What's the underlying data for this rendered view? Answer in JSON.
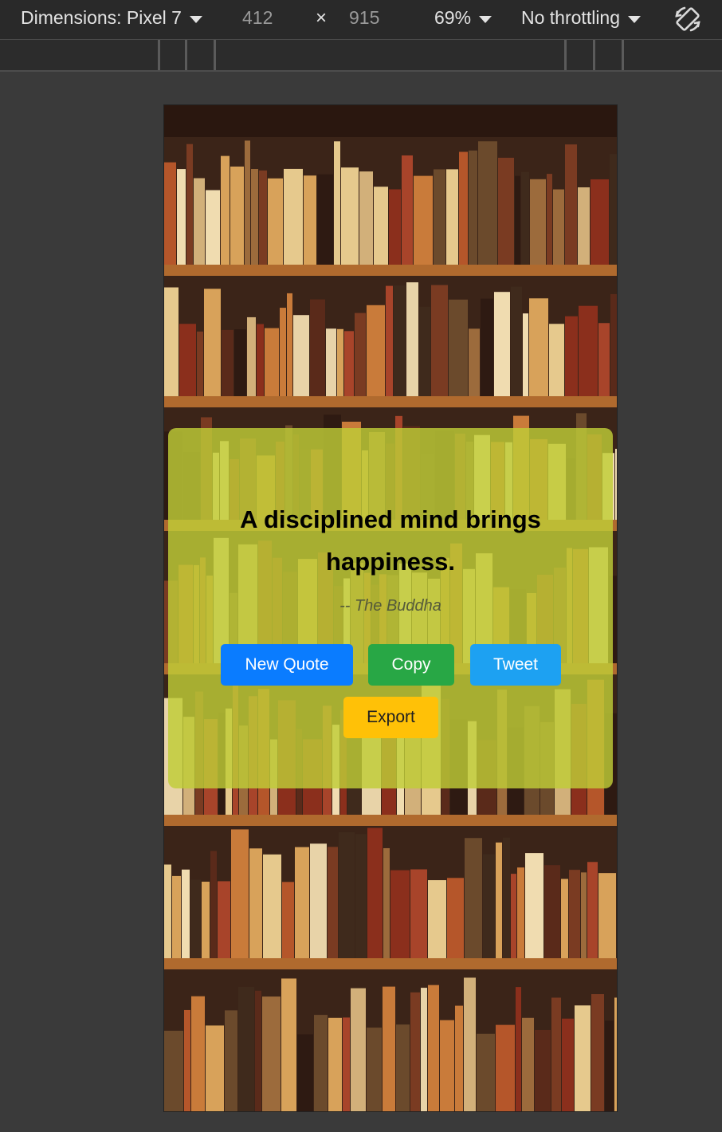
{
  "devtools": {
    "dimensions_label": "Dimensions: Pixel 7",
    "width": "412",
    "times": "×",
    "height": "915",
    "zoom": "69%",
    "throttling": "No throttling",
    "icons": [
      "chevron-down-icon",
      "rotate-icon"
    ]
  },
  "page": {
    "quote": "A disciplined mind brings happiness.",
    "author": "-- The Buddha",
    "buttons": {
      "new_quote": "New Quote",
      "copy": "Copy",
      "tweet": "Tweet",
      "export": "Export"
    }
  },
  "colors": {
    "card": "#c0cd37",
    "new_quote": "#0a7cff",
    "copy": "#28a745",
    "tweet": "#1da1f2",
    "export": "#ffc107"
  }
}
